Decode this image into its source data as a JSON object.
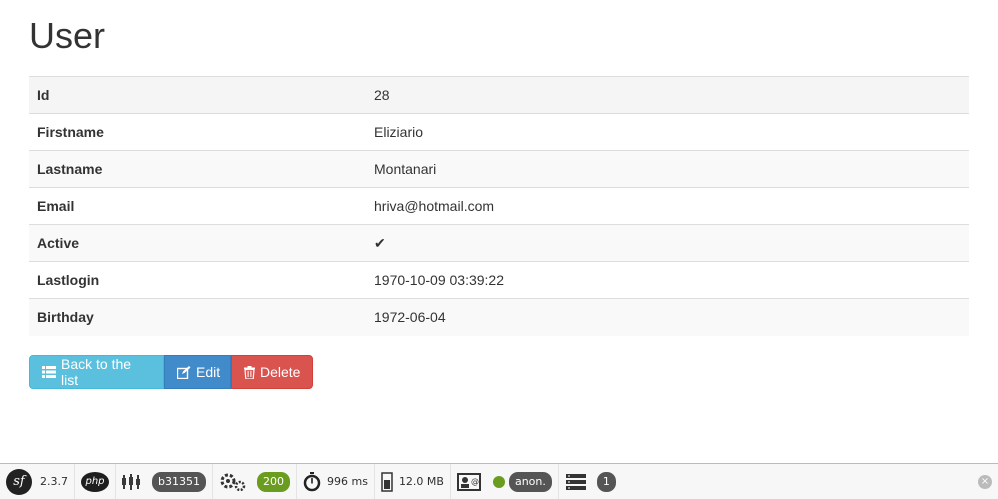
{
  "page": {
    "title": "User"
  },
  "record": {
    "rows": [
      {
        "label": "Id",
        "value": "28"
      },
      {
        "label": "Firstname",
        "value": "Eliziario"
      },
      {
        "label": "Lastname",
        "value": "Montanari"
      },
      {
        "label": "Email",
        "value": "hriva@hotmail.com"
      },
      {
        "label": "Active",
        "value": "✔"
      },
      {
        "label": "Lastlogin",
        "value": "1970-10-09 03:39:22"
      },
      {
        "label": "Birthday",
        "value": "1972-06-04"
      }
    ]
  },
  "actions": {
    "back_label": "Back to the list",
    "edit_label": "Edit",
    "delete_label": "Delete"
  },
  "toolbar": {
    "symfony_version": "2.3.7",
    "php_label": "php",
    "token": "b31351",
    "status_code": "200",
    "time": "996 ms",
    "memory": "12.0 MB",
    "user": "anon.",
    "db_queries": "1",
    "close": "×"
  },
  "colors": {
    "info": "#5bc0de",
    "primary": "#428bca",
    "danger": "#d9534f",
    "status_ok": "#6a9c1f"
  },
  "icons": [
    "list-icon",
    "edit-icon",
    "trash-icon",
    "symfony-logo",
    "php-logo",
    "timeline-icon",
    "gears-icon",
    "stopwatch-icon",
    "memory-icon",
    "user-card-icon",
    "database-icon",
    "close-icon"
  ]
}
